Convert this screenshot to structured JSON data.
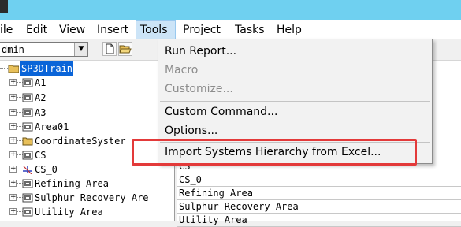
{
  "menubar": {
    "items": [
      "ile",
      "Edit",
      "View",
      "Insert",
      "Tools",
      "Project",
      "Tasks",
      "Help"
    ]
  },
  "toolbar": {
    "combo_value": "dmin",
    "combo_arrow": "▼"
  },
  "tree": {
    "root": "SP3DTrain",
    "items": [
      "A1",
      "A2",
      "A3",
      "Area01",
      "CoordinateSyster",
      "CS",
      "CS_0",
      "Refining Area",
      "Sulphur Recovery Are",
      "Utility Area"
    ]
  },
  "list": {
    "rows": [
      "CS",
      "CS_0",
      "Refining Area",
      "Sulphur Recovery Area",
      "Utility Area"
    ]
  },
  "tools_menu": {
    "items": [
      "Run Report...",
      "Macro",
      "Customize...",
      "Custom Command...",
      "Options...",
      "Import Systems Hierarchy from Excel..."
    ]
  },
  "colors": {
    "highlight": "#e33a3a",
    "selection": "#0a64d8",
    "titlebar": "#6fd0f0"
  }
}
